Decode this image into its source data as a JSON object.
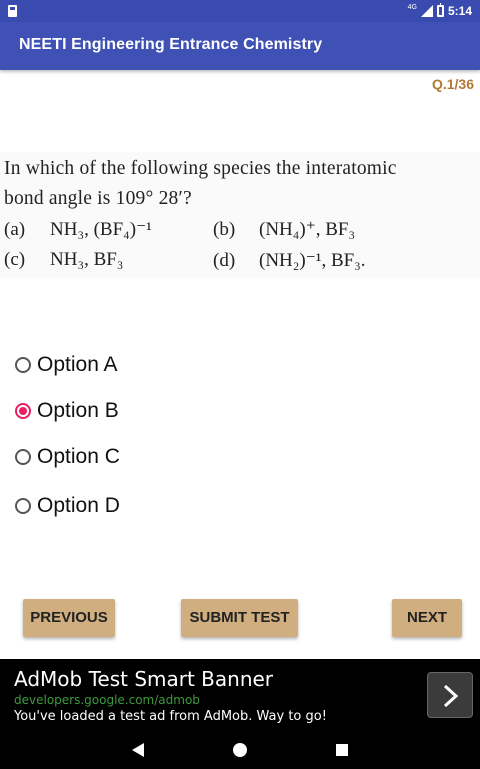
{
  "status_bar": {
    "network": "4G",
    "time": "5:14"
  },
  "app_bar": {
    "title": "NEETI Engineering Entrance Chemistry"
  },
  "question": {
    "number": "Q.1/36",
    "text_line1": "In which of the following species the interatomic",
    "text_line2": "bond angle is 109° 28′?",
    "choices": [
      {
        "tag": "(a)",
        "text": "NH₃, (BF₄)⁻¹"
      },
      {
        "tag": "(b)",
        "text": "(NH₄)⁺, BF₃"
      },
      {
        "tag": "(c)",
        "text": "NH₃, BF₃"
      },
      {
        "tag": "(d)",
        "text": "(NH₂)⁻¹, BF₃."
      }
    ]
  },
  "options": [
    {
      "label": "Option A",
      "selected": false
    },
    {
      "label": "Option B",
      "selected": true
    },
    {
      "label": "Option C",
      "selected": false
    },
    {
      "label": "Option D",
      "selected": false
    }
  ],
  "buttons": {
    "previous": "PREVIOUS",
    "submit": "SUBMIT TEST",
    "next": "NEXT"
  },
  "ad": {
    "title": "AdMob Test Smart Banner",
    "url": "developers.google.com/admob",
    "body": "You've loaded a test ad from AdMob. Way to go!"
  },
  "icons": {
    "status_left": "sd-card-icon",
    "signal": "signal-icon",
    "battery": "battery-icon",
    "ad_arrow": "chevron-right-icon",
    "nav_back": "back-icon",
    "nav_home": "home-icon",
    "nav_recent": "recent-apps-icon"
  },
  "colors": {
    "app_bar": "#3f51b5",
    "status_bar": "#3a4bb0",
    "button": "#d0ae7f",
    "radio_selected": "#e91e63",
    "question_number": "#b07a35"
  }
}
